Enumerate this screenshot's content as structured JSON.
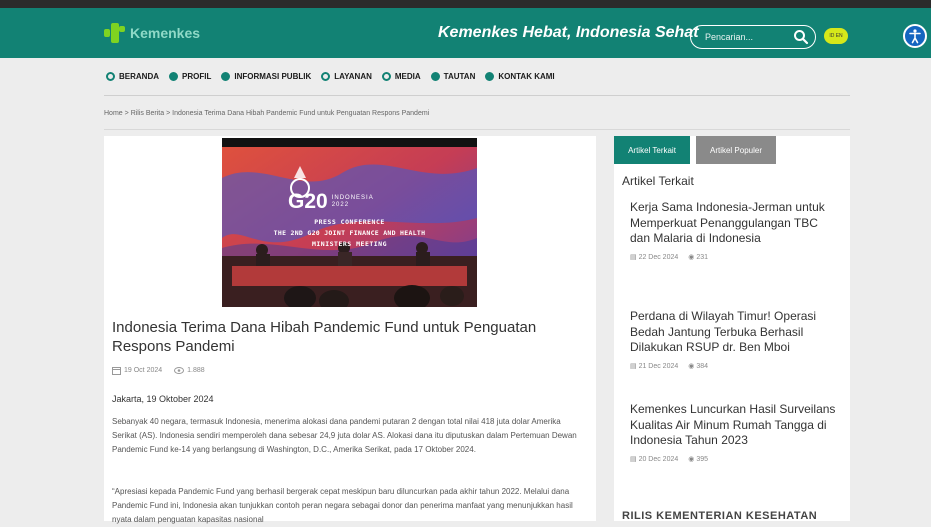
{
  "header": {
    "logo_text": "Kemenkes",
    "tagline": "Kemenkes Hebat, Indonesia Sehat",
    "search_placeholder": "Pencarian...",
    "lang_label": "ID EN",
    "accent": "#128274"
  },
  "nav": {
    "items": [
      {
        "label": "BERANDA",
        "icon": "circle-outline-icon"
      },
      {
        "label": "PROFIL",
        "icon": "circle-filled-icon"
      },
      {
        "label": "INFORMASI PUBLIK",
        "icon": "check-circle-icon"
      },
      {
        "label": "LAYANAN",
        "icon": "circle-outline-icon"
      },
      {
        "label": "MEDIA",
        "icon": "circle-outline-icon"
      },
      {
        "label": "TAUTAN",
        "icon": "circle-filled-icon"
      },
      {
        "label": "KONTAK KAMI",
        "icon": "circle-filled-icon"
      }
    ]
  },
  "breadcrumb": {
    "home": "Home",
    "section": "Rilis Berita",
    "current": "Indonesia Terima Dana Hibah Pandemic Fund untuk Penguatan Respons Pandemi",
    "separator": ">"
  },
  "hero": {
    "logo": "G20",
    "logo_sub": "INDONESIA 2022",
    "line1": "PRESS CONFERENCE",
    "line2": "THE 2ND G20 JOINT FINANCE AND HEALTH",
    "line3": "MINISTERS MEETING"
  },
  "article": {
    "title": "Indonesia Terima Dana Hibah Pandemic Fund untuk Penguatan Respons Pandemi",
    "date": "19 Oct 2024",
    "views": "1.888",
    "dateline": "Jakarta, 19 Oktober 2024",
    "paragraphs": [
      "Sebanyak 40 negara, termasuk Indonesia, menerima alokasi dana pandemi putaran 2 dengan total nilai 418 juta dolar Amerika Serikat (AS). Indonesia sendiri memperoleh dana sebesar 24,9 juta dolar AS. Alokasi dana itu diputuskan dalam Pertemuan Dewan Pandemic Fund ke-14 yang berlangsung di Washington, D.C., Amerika Serikat, pada 17 Oktober 2024.",
      "“Apresiasi kepada Pandemic Fund yang berhasil bergerak cepat meskipun baru diluncurkan pada akhir tahun 2022. Melalui dana Pandemic Fund ini, Indonesia akan tunjukkan contoh peran negara sebagai donor dan penerima manfaat yang menunjukkan hasil nyata dalam penguatan kapasitas nasional"
    ]
  },
  "sidebar": {
    "tabs": [
      "Artikel Terkait",
      "Artikel Populer"
    ],
    "heading": "Artikel Terkait",
    "items": [
      {
        "title": "Kerja Sama Indonesia-Jerman untuk Memperkuat Penanggulangan TBC dan Malaria di Indonesia",
        "date": "22 Dec 2024",
        "views": "231"
      },
      {
        "title": "Perdana di Wilayah Timur! Operasi Bedah Jantung Terbuka Berhasil Dilakukan RSUP dr. Ben Mboi",
        "date": "21 Dec 2024",
        "views": "384"
      },
      {
        "title": "Kemenkes Luncurkan Hasil Surveilans Kualitas Air Minum Rumah Tangga di Indonesia Tahun 2023",
        "date": "20 Dec 2024",
        "views": "395"
      }
    ],
    "bottom_heading": "RILIS KEMENTERIAN KESEHATAN"
  }
}
